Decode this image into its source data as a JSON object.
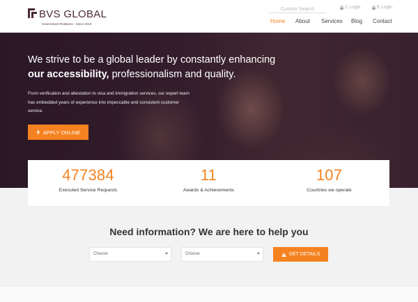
{
  "colors": {
    "accent": "#f58220",
    "brand": "#4a2a33",
    "hero_overlay": "#2f1b2b"
  },
  "header": {
    "logo_text": "BVS GLOBAL",
    "logo_tagline": "Government Relations - Since 2010",
    "search_placeholder": "Custom Search",
    "c_login": "C Login",
    "e_login": "E Login",
    "nav": [
      "Home",
      "About",
      "Services",
      "Blog",
      "Contact"
    ],
    "active_nav": "Home"
  },
  "hero": {
    "headline_line1": "We strive to be a global leader by constantly enhancing",
    "headline_strong": "our accessibility,",
    "headline_rest": " professionalism and quality.",
    "paragraph": "From verification and attestation to visa and immigration services, our expert team has embedded years of experience into impeccable and consistent customer service.",
    "apply_label": "APPLY ONLINE",
    "apply_icon": "lightning-icon"
  },
  "stats": [
    {
      "value": "477384",
      "label": "Executed Service Requests"
    },
    {
      "value": "11",
      "label": "Awards & Achievements"
    },
    {
      "value": "107",
      "label": "Countries we operate"
    }
  ],
  "info": {
    "title": "Need information? We are here to help you",
    "select1": "Choose",
    "select2": "Choose",
    "button_label": "GET DETAILS",
    "button_icon": "warning-icon"
  }
}
